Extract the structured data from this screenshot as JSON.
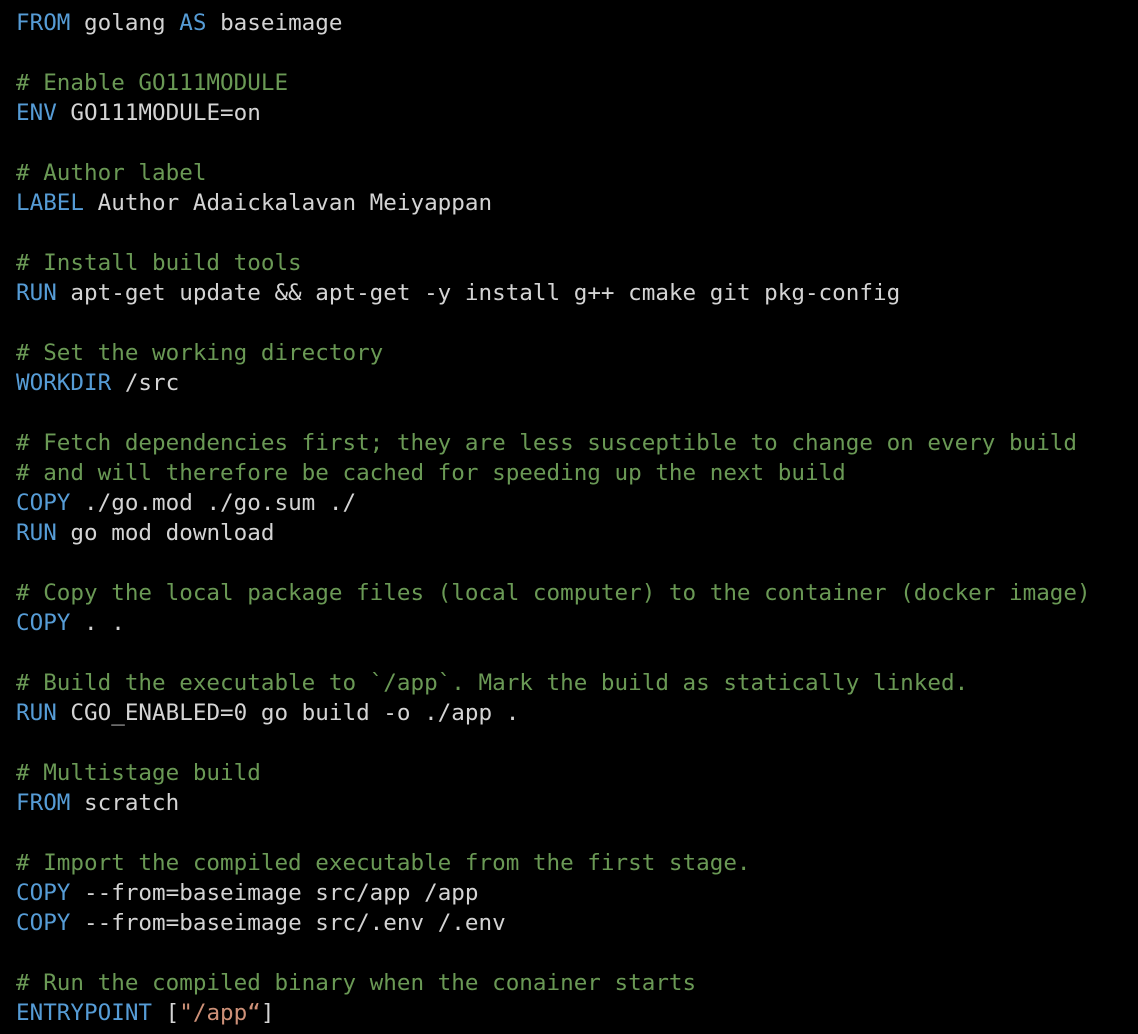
{
  "lines": [
    {
      "type": "instruction",
      "keyword": "FROM",
      "rest": " golang ",
      "keyword2": "AS",
      "rest2": " baseimage"
    },
    {
      "type": "blank"
    },
    {
      "type": "comment",
      "text": "# Enable GO111MODULE"
    },
    {
      "type": "instruction",
      "keyword": "ENV",
      "rest": " GO111MODULE=on"
    },
    {
      "type": "blank"
    },
    {
      "type": "comment",
      "text": "# Author label"
    },
    {
      "type": "instruction",
      "keyword": "LABEL",
      "rest": " Author Adaickalavan Meiyappan"
    },
    {
      "type": "blank"
    },
    {
      "type": "comment",
      "text": "# Install build tools"
    },
    {
      "type": "instruction",
      "keyword": "RUN",
      "rest": " apt-get update && apt-get -y install g++ cmake git pkg-config"
    },
    {
      "type": "blank"
    },
    {
      "type": "comment",
      "text": "# Set the working directory"
    },
    {
      "type": "instruction",
      "keyword": "WORKDIR",
      "rest": " /src"
    },
    {
      "type": "blank"
    },
    {
      "type": "comment",
      "text": "# Fetch dependencies first; they are less susceptible to change on every build"
    },
    {
      "type": "comment",
      "text": "# and will therefore be cached for speeding up the next build"
    },
    {
      "type": "instruction",
      "keyword": "COPY",
      "rest": " ./go.mod ./go.sum ./"
    },
    {
      "type": "instruction",
      "keyword": "RUN",
      "rest": " go mod download"
    },
    {
      "type": "blank"
    },
    {
      "type": "comment",
      "text": "# Copy the local package files (local computer) to the container (docker image)"
    },
    {
      "type": "instruction",
      "keyword": "COPY",
      "rest": " . ."
    },
    {
      "type": "blank"
    },
    {
      "type": "comment",
      "text": "# Build the executable to `/app`. Mark the build as statically linked."
    },
    {
      "type": "instruction",
      "keyword": "RUN",
      "rest": " CGO_ENABLED=0 go build -o ./app ."
    },
    {
      "type": "blank"
    },
    {
      "type": "comment",
      "text": "# Multistage build"
    },
    {
      "type": "instruction",
      "keyword": "FROM",
      "rest": " scratch"
    },
    {
      "type": "blank"
    },
    {
      "type": "comment",
      "text": "# Import the compiled executable from the first stage."
    },
    {
      "type": "instruction",
      "keyword": "COPY",
      "rest": " --from=baseimage src/app /app"
    },
    {
      "type": "instruction",
      "keyword": "COPY",
      "rest": " --from=baseimage src/.env /.env"
    },
    {
      "type": "blank"
    },
    {
      "type": "comment",
      "text": "# Run the compiled binary when the conainer starts"
    },
    {
      "type": "instruction",
      "keyword": "ENTRYPOINT",
      "rest": " [",
      "string": "\"/app“",
      "rest2": "]"
    }
  ],
  "colors": {
    "background": "#000000",
    "keyword": "#569cd6",
    "comment": "#6a9955",
    "text": "#d4d4d4",
    "string": "#ce9178"
  }
}
